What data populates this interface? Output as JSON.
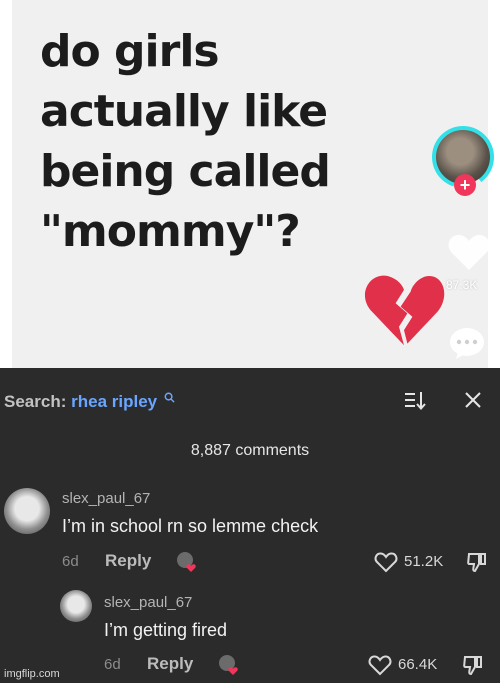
{
  "video": {
    "caption_lines": [
      "do girls",
      "actually like",
      "being called",
      "\"mommy\"?"
    ],
    "like_count": "87.3K"
  },
  "comments_panel": {
    "search_label": "Search:",
    "search_query": "rhea ripley",
    "comment_count": "8,887 comments",
    "comments": [
      {
        "username": "slex_paul_67",
        "text": "I’m in school rn so lemme check",
        "time": "6d",
        "reply_label": "Reply",
        "likes": "51.2K"
      },
      {
        "username": "slex_paul_67",
        "text": "I’m getting fired",
        "time": "6d",
        "reply_label": "Reply",
        "likes": "66.4K"
      }
    ]
  },
  "watermark": "imgflip.com",
  "colors": {
    "video_bg": "#f0f0f0",
    "panel_bg": "#2b2b2b",
    "search_query": "#6aa6ff",
    "follow_plus": "#f0365a",
    "broken_heart": "#e0304a",
    "avatar_ring": "#33e0e8"
  },
  "icons": [
    "broken-heart-icon",
    "plus-icon",
    "heart-icon",
    "comment-icon",
    "search-icon",
    "sort-icon",
    "close-icon",
    "creator-liked-icon",
    "like-heart-icon",
    "dislike-icon"
  ]
}
